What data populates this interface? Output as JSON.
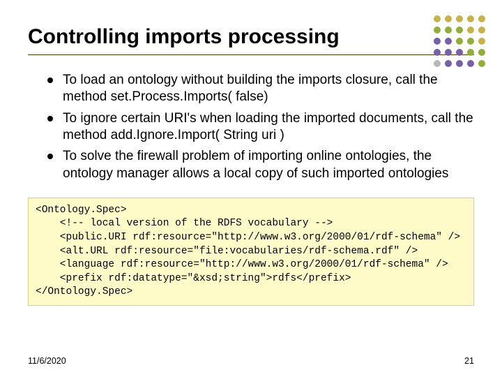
{
  "title": "Controlling imports processing",
  "bullets": [
    "To load an ontology without building the imports closure, call the method set.Process.Imports( false)",
    "To ignore certain URI's when loading the imported documents, call the method add.Ignore.Import( String uri )",
    "To solve the firewall problem of importing online ontologies, the ontology manager allows a local copy of such imported ontologies"
  ],
  "code": {
    "line1": "<Ontology.Spec>",
    "line2": "    <!-- local version of the RDFS vocabulary -->",
    "line3": "    <public.URI rdf:resource=\"http://www.w3.org/2000/01/rdf-schema\" />",
    "line4": "    <alt.URL rdf:resource=\"file:vocabularies/rdf-schema.rdf\" />",
    "line5": "    <language rdf:resource=\"http://www.w3.org/2000/01/rdf-schema\" />",
    "line6": "    <prefix rdf:datatype=\"&xsd;string\">rdfs</prefix>",
    "line7": "</Ontology.Spec>"
  },
  "footer": {
    "date": "11/6/2020",
    "page": "21"
  },
  "dotColors": [
    "#c7b34a",
    "#c7b34a",
    "#c7b34a",
    "#c7b34a",
    "#c7b34a",
    "#8fae3a",
    "#8fae3a",
    "#8fae3a",
    "#c7b34a",
    "#c7b34a",
    "#7a5ea8",
    "#7a5ea8",
    "#8fae3a",
    "#8fae3a",
    "#c7b34a",
    "#7a5ea8",
    "#7a5ea8",
    "#7a5ea8",
    "#8fae3a",
    "#8fae3a",
    "#b8b8b8",
    "#7a5ea8",
    "#7a5ea8",
    "#7a5ea8",
    "#8fae3a"
  ]
}
